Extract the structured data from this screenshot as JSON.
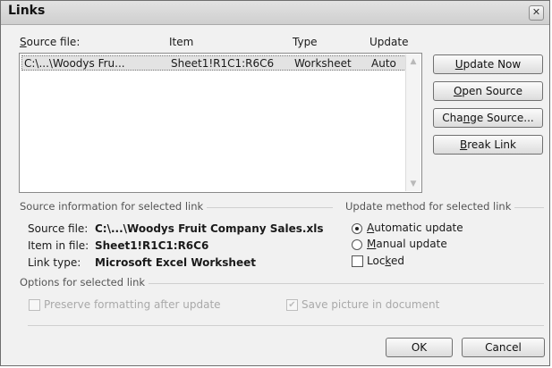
{
  "window": {
    "title": "Links",
    "close_glyph": "✕"
  },
  "list": {
    "headers": {
      "source_file": "Source file:",
      "item": "Item",
      "type": "Type",
      "update": "Update"
    },
    "rows": [
      {
        "source_file": "C:\\...\\Woodys Fru...",
        "item": "Sheet1!R1C1:R6C6",
        "type": "Worksheet",
        "update": "Auto"
      }
    ],
    "scroll_up_icon": "▲",
    "scroll_down_icon": "▼"
  },
  "buttons": {
    "update_now": "Update Now",
    "open_source": "Open Source",
    "change_source": "Change Source...",
    "break_link": "Break Link",
    "ok": "OK",
    "cancel": "Cancel"
  },
  "source_info": {
    "heading": "Source information for selected link",
    "source_file_label": "Source file:",
    "source_file_value": "C:\\...\\Woodys Fruit Company Sales.xls",
    "item_label": "Item in file:",
    "item_value": "Sheet1!R1C1:R6C6",
    "link_type_label": "Link type:",
    "link_type_value": "Microsoft Excel Worksheet"
  },
  "update_method": {
    "heading": "Update method for selected link",
    "automatic": "Automatic update",
    "manual": "Manual update",
    "locked": "Locked",
    "selected": "automatic"
  },
  "options": {
    "heading": "Options for selected link",
    "preserve_formatting": "Preserve formatting after update",
    "preserve_formatting_checked": false,
    "save_picture": "Save picture in document",
    "save_picture_checked": true,
    "check_glyph": "✔"
  }
}
